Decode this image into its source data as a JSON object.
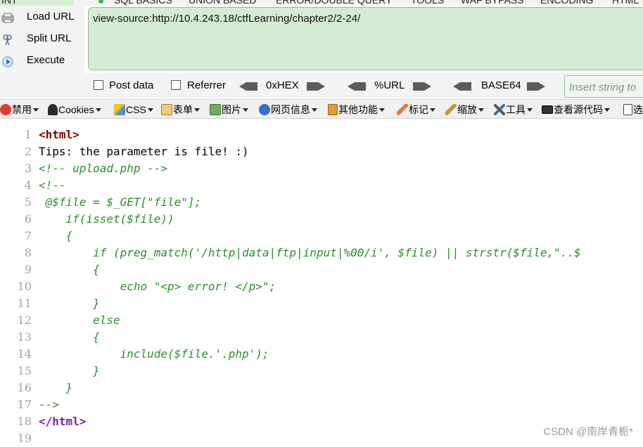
{
  "hackbar": {
    "menu": [
      "INT",
      "SQL BASICS",
      "UNION BASED",
      "ERROR/DOUBLE QUERY",
      "TOOLS",
      "WAF BYPASS",
      "ENCODING",
      "HTML"
    ],
    "actions": [
      {
        "label": "Load URL",
        "icon": "load-url-icon"
      },
      {
        "label": "Split URL",
        "icon": "split-url-icon"
      },
      {
        "label": "Execute",
        "icon": "execute-icon"
      }
    ],
    "url": "view-source:http://10.4.243.18/ctfLearning/chapter2/2-24/",
    "options": {
      "post_data": "Post data",
      "referrer": "Referrer",
      "hex": "0xHEX",
      "url": "%URL",
      "base64": "BASE64",
      "insert_placeholder": "Insert string to"
    }
  },
  "devbar": {
    "items": [
      "禁用",
      "Cookies",
      "CSS",
      "表单",
      "图片",
      "网页信息",
      "其他功能",
      "标记",
      "缩放",
      "工具",
      "查看源代码",
      "选"
    ]
  },
  "source_lines": [
    {
      "n": "1",
      "text": "<html>"
    },
    {
      "n": "2",
      "text": "Tips: the parameter is file! :)"
    },
    {
      "n": "3",
      "text": "<!-- upload.php -->"
    },
    {
      "n": "4",
      "text": "<!--"
    },
    {
      "n": "5",
      "text": " @$file = $_GET[\"file\"];"
    },
    {
      "n": "6",
      "text": "    if(isset($file))"
    },
    {
      "n": "7",
      "text": "    {"
    },
    {
      "n": "8",
      "text": "        if (preg_match('/http|data|ftp|input|%00/i', $file) || strstr($file,\"..$"
    },
    {
      "n": "9",
      "text": "        {"
    },
    {
      "n": "10",
      "text": "            echo \"<p> error! </p>\";"
    },
    {
      "n": "11",
      "text": "        }"
    },
    {
      "n": "12",
      "text": "        else"
    },
    {
      "n": "13",
      "text": "        {"
    },
    {
      "n": "14",
      "text": "            include($file.'.php');"
    },
    {
      "n": "15",
      "text": "        }"
    },
    {
      "n": "16",
      "text": "    }"
    },
    {
      "n": "17",
      "text": "-->"
    },
    {
      "n": "18",
      "text": "</html>"
    },
    {
      "n": "19",
      "text": ""
    }
  ],
  "watermark": "CSDN @南岸青栀*",
  "colors": {
    "url_box": "#d3ecd3",
    "comment": "#2e8b2e",
    "tag": "#800000"
  }
}
